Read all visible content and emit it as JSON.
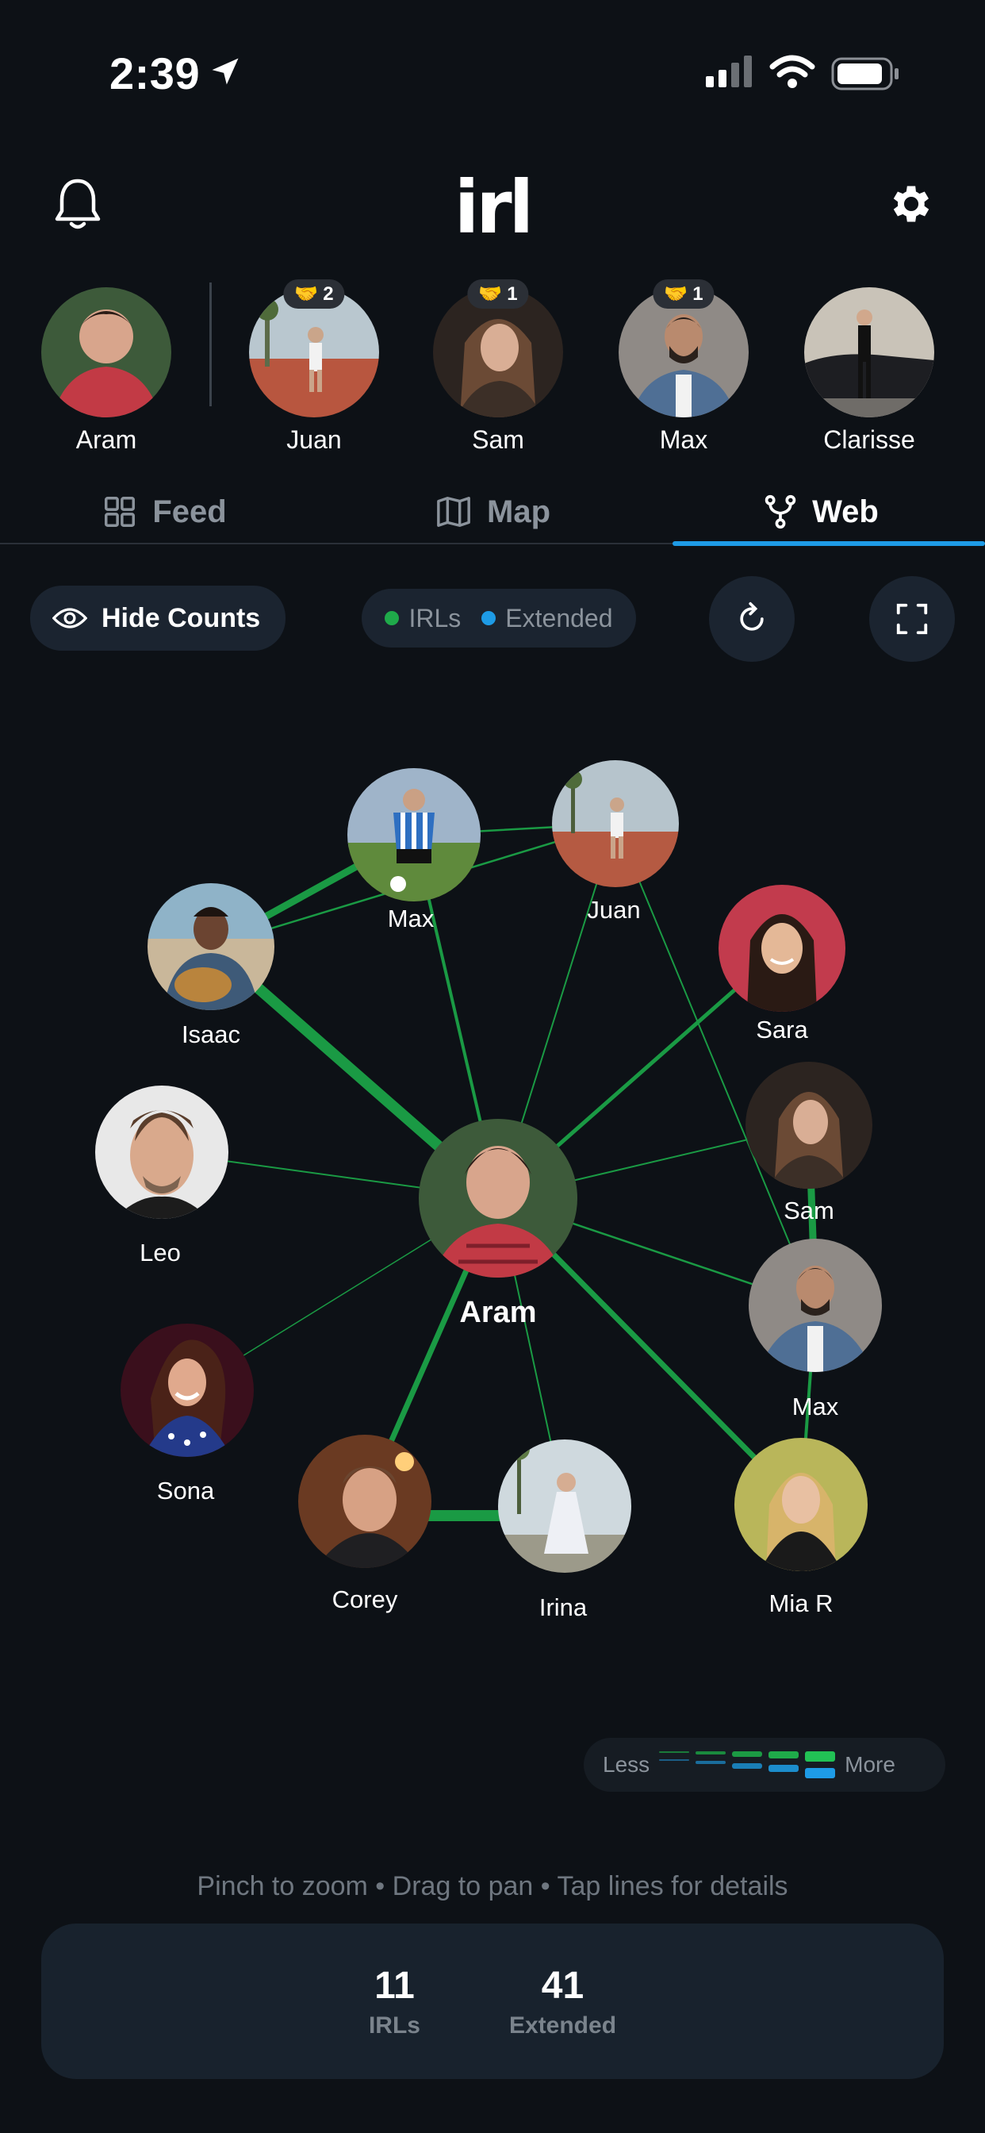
{
  "status_bar": {
    "time": "2:39"
  },
  "header": {
    "logo": "irl"
  },
  "stories": [
    {
      "name": "Aram",
      "badge": ""
    },
    {
      "name": "Juan",
      "badge": "2"
    },
    {
      "name": "Sam",
      "badge": "1"
    },
    {
      "name": "Max",
      "badge": "1"
    },
    {
      "name": "Clarisse",
      "badge": ""
    }
  ],
  "tabs": [
    {
      "label": "Feed",
      "active": false
    },
    {
      "label": "Map",
      "active": false
    },
    {
      "label": "Web",
      "active": true
    }
  ],
  "controls": {
    "hide_counts": "Hide Counts",
    "legend_irls": "IRLs",
    "legend_extended": "Extended"
  },
  "graph": {
    "center": "Aram",
    "nodes": [
      "Max",
      "Juan",
      "Isaac",
      "Sara",
      "Leo",
      "Sam",
      "Max",
      "Sona",
      "Corey",
      "Irina",
      "Mia R"
    ]
  },
  "strength_legend": {
    "less": "Less",
    "more": "More"
  },
  "hint": "Pinch to zoom • Drag to pan • Tap lines for details",
  "stats": {
    "irls_value": "11",
    "irls_label": "IRLs",
    "extended_value": "41",
    "extended_label": "Extended"
  },
  "colors": {
    "background": "#0d1116",
    "irl_green": "#1faa4a",
    "extended_blue": "#1e9be6",
    "panel": "#18222d"
  }
}
